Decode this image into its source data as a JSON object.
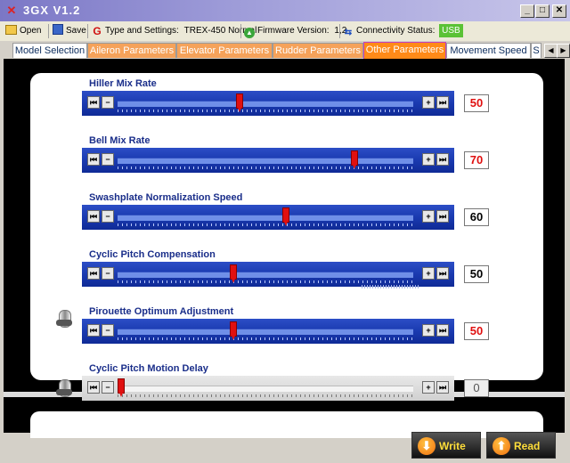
{
  "window": {
    "title": "3GX  V1.2",
    "icons": {
      "app": "helicopter-icon",
      "minimize": "minimize-icon",
      "maximize": "maximize-icon",
      "close": "close-icon"
    }
  },
  "toolbar": {
    "open_label": "Open",
    "save_label": "Save",
    "type_label": "Type and Settings:",
    "type_value": "TREX-450 Normal",
    "firmware_label": "Firmware Version:",
    "firmware_value": "1,2",
    "connectivity_label": "Connectivity Status:",
    "connectivity_value": "USB",
    "colors": {
      "usb": "#5bc236"
    }
  },
  "tabs": [
    {
      "label": "Model Selection",
      "style": "plain"
    },
    {
      "label": "Aileron Parameters",
      "style": "orange"
    },
    {
      "label": "Elevator Parameters",
      "style": "orange"
    },
    {
      "label": "Rudder Parameters",
      "style": "orange"
    },
    {
      "label": "Other Parameters",
      "style": "active"
    },
    {
      "label": "Movement Speed",
      "style": "plain"
    },
    {
      "label": "S",
      "style": "plain"
    }
  ],
  "sliders": [
    {
      "label": "Hiller Mix Rate",
      "value": "50",
      "fraction": 0.41,
      "color": "red"
    },
    {
      "label": "Bell Mix Rate",
      "value": "70",
      "fraction": 0.81,
      "color": "red"
    },
    {
      "label": "Swashplate Normalization Speed",
      "value": "60",
      "fraction": 0.57,
      "color": "black"
    },
    {
      "label": "Cyclic Pitch Compensation",
      "value": "50",
      "fraction": 0.39,
      "color": "black"
    },
    {
      "label": "Pirouette Optimum Adjustment",
      "value": "50",
      "fraction": 0.39,
      "color": "red"
    },
    {
      "label": "Cyclic Pitch Motion Delay",
      "value": "0",
      "fraction": 0.0,
      "color": "dim"
    }
  ],
  "slider_buttons": {
    "first": "⏮",
    "minus": "−",
    "plus": "+",
    "last": "⏭"
  },
  "buttons": {
    "write_label": "Write",
    "read_label": "Read"
  }
}
